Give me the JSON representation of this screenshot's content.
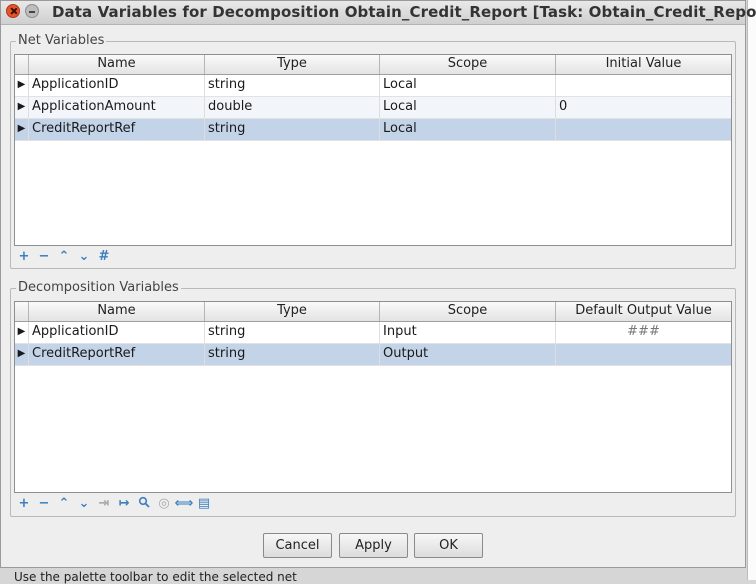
{
  "window": {
    "title": "Data Variables for Decomposition Obtain_Credit_Report [Task: Obtain_Credit_Report]"
  },
  "background": {
    "status_text": "Use the palette toolbar to edit the selected net"
  },
  "net_variables": {
    "label": "Net Variables",
    "columns": [
      "Name",
      "Type",
      "Scope",
      "Initial Value"
    ],
    "rows": [
      {
        "name": "ApplicationID",
        "type": "string",
        "scope": "Local",
        "value": ""
      },
      {
        "name": "ApplicationAmount",
        "type": "double",
        "scope": "Local",
        "value": "0"
      },
      {
        "name": "CreditReportRef",
        "type": "string",
        "scope": "Local",
        "value": ""
      }
    ],
    "selected_row": 2
  },
  "decomposition_variables": {
    "label": "Decomposition Variables",
    "columns": [
      "Name",
      "Type",
      "Scope",
      "Default Output Value"
    ],
    "rows": [
      {
        "name": "ApplicationID",
        "type": "string",
        "scope": "Input",
        "value": "###"
      },
      {
        "name": "CreditReportRef",
        "type": "string",
        "scope": "Output",
        "value": ""
      }
    ],
    "selected_row": 1
  },
  "row_marker": "▶",
  "toolbar_glyphs": {
    "add": "+",
    "remove": "−",
    "up": "⌃",
    "down": "⌄",
    "format": "#",
    "indent": "⇥",
    "mapping": "↦",
    "search": "🔍",
    "target": "◎",
    "binding": "⟺",
    "list": "▤"
  },
  "buttons": {
    "cancel": "Cancel",
    "apply": "Apply",
    "ok": "OK"
  },
  "colors": {
    "selection": "#c3d3e8",
    "toolbar_icon": "#3a7fbf",
    "close_button": "#e6552a"
  }
}
